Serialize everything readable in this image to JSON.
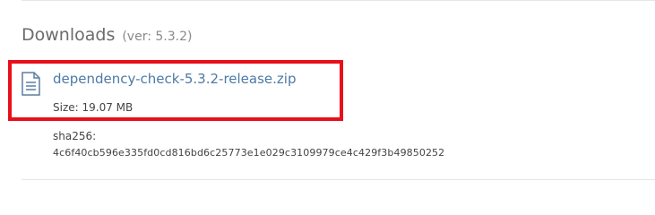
{
  "downloads": {
    "title": "Downloads",
    "version": "(ver: 5.3.2)",
    "file": {
      "name": "dependency-check-5.3.2-release.zip",
      "size": "Size: 19.07 MB",
      "sha_label": "sha256:",
      "sha_value": "4c6f40cb596e335fd0cd816bd6c25773e1e029c3109979ce4c429f3b49850252",
      "icon": "document-icon"
    },
    "highlight_color": "#e8101a",
    "link_color": "#4d7aa6"
  }
}
